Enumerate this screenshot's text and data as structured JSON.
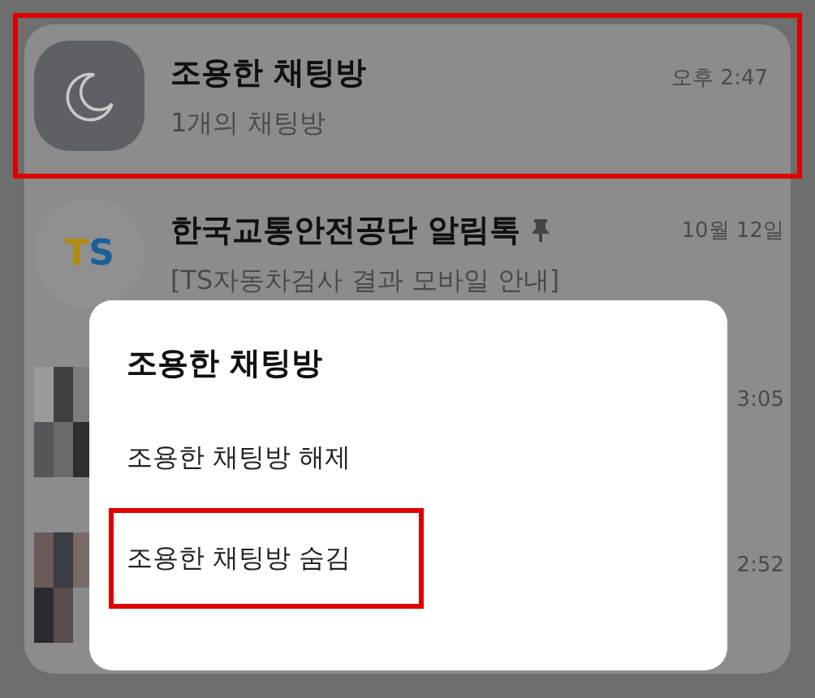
{
  "chat_list": [
    {
      "kind": "folder",
      "title": "조용한 채팅방",
      "subtitle": "1개의 채팅방",
      "time": "오후 2:47",
      "highlighted": true,
      "pinned": false
    },
    {
      "kind": "logo",
      "logo_text": "TS",
      "title": "한국교통안전공단 알림톡",
      "subtitle": "[TS자동차검사 결과 모바일 안내]",
      "time": "10월 12일",
      "highlighted": false,
      "pinned": true
    },
    {
      "time": "3:05",
      "highlighted": false
    },
    {
      "time": "2:52",
      "highlighted": false
    }
  ],
  "dialog": {
    "title": "조용한 채팅방",
    "options": [
      {
        "label": "조용한 채팅방 해제",
        "highlighted": false
      },
      {
        "label": "조용한 채팅방 숨김",
        "highlighted": true
      }
    ]
  }
}
